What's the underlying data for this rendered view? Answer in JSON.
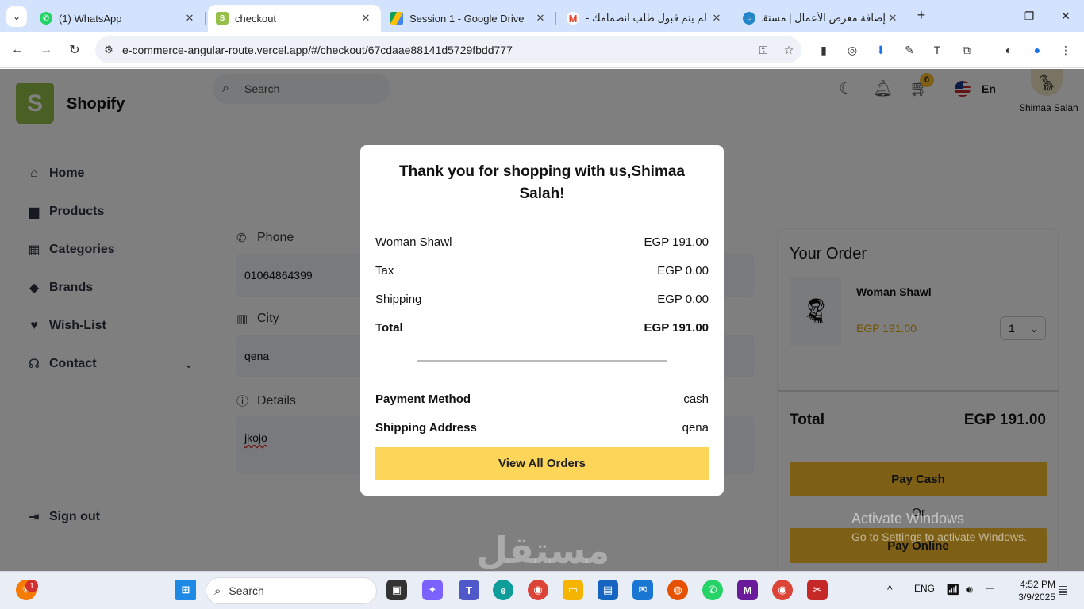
{
  "browser": {
    "tabs": [
      {
        "title": "(1) WhatsApp",
        "active": false,
        "favicon": "whatsapp-icon",
        "color": "#25d366"
      },
      {
        "title": "checkout",
        "active": true,
        "favicon": "shopify-icon",
        "color": "#95bf47"
      },
      {
        "title": "Session 1 - Google Drive",
        "active": false,
        "favicon": "google-drive-icon",
        "color": "#fbbc04"
      },
      {
        "title": "لم يتم قبول طلب انضمامك -",
        "active": false,
        "favicon": "gmail-icon",
        "color": "#ea4335"
      },
      {
        "title": "إضافة معرض الأعمال | مستقل",
        "active": false,
        "favicon": "mostaql-icon",
        "color": "#2386c8"
      }
    ],
    "url": "e-commerce-angular-route.vercel.app/#/checkout/67cdaae88141d5729fbdd777"
  },
  "app": {
    "brand": "Shopify",
    "search_placeholder": "Search",
    "cart_count": "0",
    "language": "En",
    "user_name": "Shimaa Salah",
    "nav": [
      {
        "label": "Home",
        "icon": "home-icon"
      },
      {
        "label": "Products",
        "icon": "briefcase-icon"
      },
      {
        "label": "Categories",
        "icon": "grid-icon"
      },
      {
        "label": "Brands",
        "icon": "tag-icon"
      },
      {
        "label": "Wish-List",
        "icon": "heart-icon"
      },
      {
        "label": "Contact",
        "icon": "headset-icon"
      }
    ],
    "sign_out": "Sign out"
  },
  "form": {
    "phone_label": "Phone",
    "phone_value": "01064864399",
    "city_label": "City",
    "city_value": "qena",
    "details_label": "Details",
    "details_value": "jkojo"
  },
  "order": {
    "title": "Your Order",
    "product_name": "Woman Shawl",
    "product_price": "EGP 191.00",
    "quantity": "1",
    "total_label": "Total",
    "total_value": "EGP 191.00",
    "pay_cash": "Pay Cash",
    "or": "Or",
    "pay_online": "Pay Online"
  },
  "modal": {
    "title": "Thank you for shopping with us,Shimaa Salah!",
    "rows": [
      {
        "label": "Woman Shawl",
        "value": "EGP 191.00"
      },
      {
        "label": "Tax",
        "value": "EGP 0.00"
      },
      {
        "label": "Shipping",
        "value": "EGP 0.00"
      },
      {
        "label": "Total",
        "value": "EGP 191.00"
      }
    ],
    "payment_label": "Payment Method",
    "payment_value": "cash",
    "address_label": "Shipping Address",
    "address_value": "qena",
    "button": "View All Orders"
  },
  "watermark": {
    "line1": "Activate Windows",
    "line2": "Go to Settings to activate Windows.",
    "mostaql": "مستقل"
  },
  "taskbar": {
    "search_placeholder": "Search",
    "language": "ENG",
    "time": "4:52 PM",
    "date": "3/9/2025",
    "notification_count": "1"
  },
  "colors": {
    "accent": "#fbc02d",
    "modal_button": "#fcd559",
    "price": "#e5a400"
  }
}
